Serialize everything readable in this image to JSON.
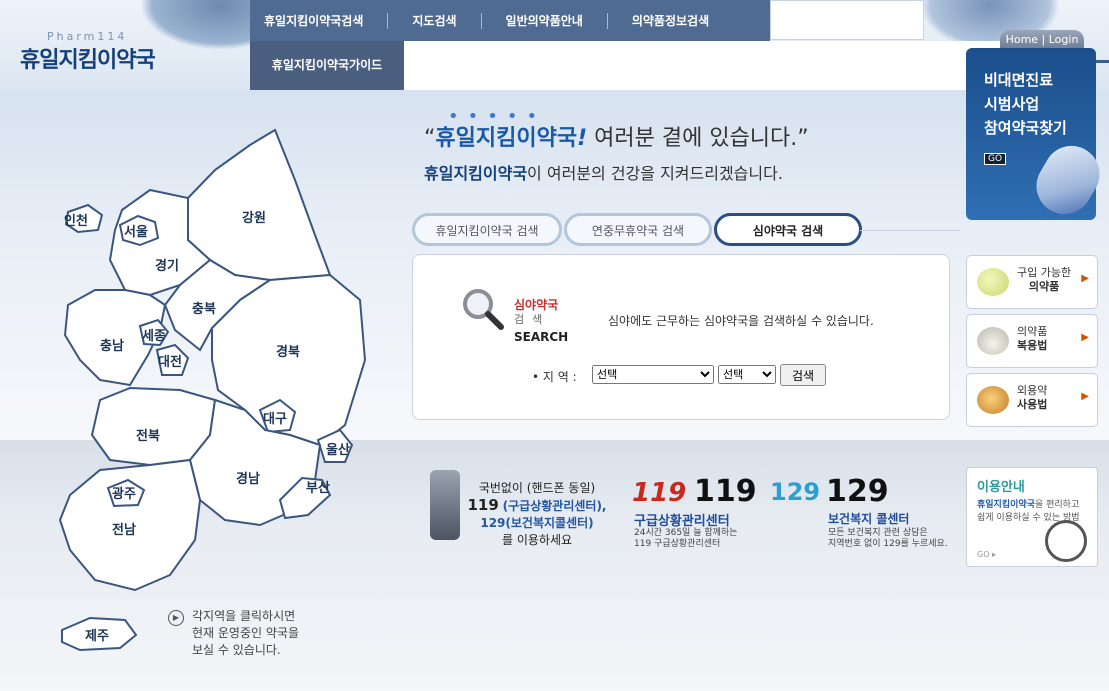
{
  "logo": {
    "sub": "Pharm114",
    "main": "휴일지킴이약국"
  },
  "nav": {
    "items": [
      "휴일지킴이약국검색",
      "지도검색",
      "일반의약품안내",
      "의약품정보검색"
    ],
    "sub": "휴일지킴이약국가이드"
  },
  "account": {
    "home_login": "Home | Login"
  },
  "headline": {
    "quote_open": "“",
    "brand": "휴일지킴이약국",
    "mark": "!",
    "rest": "여러분 곁에 있습니다.”",
    "sub_brand": "휴일지킴이약국",
    "sub_rest": "이 여러분의 건강을 지켜드리겠습니다."
  },
  "tabs": [
    "휴일지킴이약국 검색",
    "연중무휴약국 검색",
    "심야약국 검색"
  ],
  "search": {
    "title": "심야약국",
    "subtitle": "검색",
    "en": "SEARCH",
    "desc": "심야에도 근무하는 심야약국을 검색하실 수 있습니다.",
    "area_label": "• 지 역 :",
    "select1": "선택",
    "select2": "선택",
    "button": "검색"
  },
  "banner": {
    "line1": "비대면진료",
    "line2": "시범사업",
    "line3": "참여약국찾기",
    "go": "GO"
  },
  "side": [
    {
      "l1": "구입 가능한",
      "l2": "의약품"
    },
    {
      "l1": "의약품",
      "l2": "복용법"
    },
    {
      "l1": "외용약",
      "l2": "사용법"
    }
  ],
  "map": {
    "regions": [
      "인천",
      "서울",
      "경기",
      "강원",
      "충북",
      "충남",
      "세종",
      "대전",
      "경북",
      "대구",
      "울산",
      "전북",
      "경남",
      "부산",
      "광주",
      "전남",
      "제주"
    ],
    "note": [
      "각지역을 클릭하시면",
      "현재 운영중인 약국을",
      "보실 수 있습니다."
    ]
  },
  "info": {
    "line1": "국번없이 (핸드폰 동일)",
    "line2": "119",
    "line2b": "(구급상황관리센터),",
    "line3": "129(보건복지콜센터)",
    "line4": "를 이용하세요",
    "n119": "119",
    "n119_logo": "119",
    "n119_title": "구급상황관리센터",
    "n119_s1": "24시간 365일 늘 함께하는",
    "n119_s2": "119 구급상황관리센터",
    "n129": "129",
    "n129_logo": "129",
    "n129_title": "보건복지 콜센터",
    "n129_s1": "모든 보건복지 관련 상담은",
    "n129_s2": "지역번호 없이 129를 누르세요."
  },
  "guide": {
    "title": "이용안내",
    "brand": "휴일지킴이약국",
    "text": "을 편리하고 쉽게 이용하실 수 있는 방법",
    "go": "GO ▸"
  },
  "colors": {
    "brand": "#16407c",
    "accent": "#1a58a8",
    "nav": "#506b92"
  }
}
